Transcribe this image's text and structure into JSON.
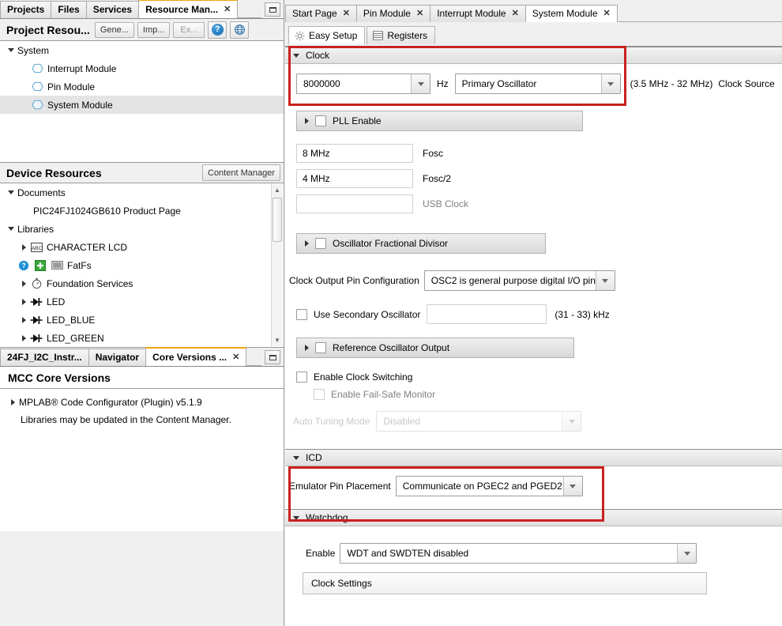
{
  "left_panel": {
    "tabs": [
      {
        "label": "Projects",
        "closable": false,
        "active": false
      },
      {
        "label": "Files",
        "closable": false,
        "active": false
      },
      {
        "label": "Services",
        "closable": false,
        "active": false
      },
      {
        "label": "Resource Man...",
        "closable": true,
        "active": true
      }
    ],
    "minimize_icon": "minimize-icon",
    "project_resources": {
      "title": "Project Resou...",
      "buttons": [
        {
          "label": "Gene...",
          "disabled": false
        },
        {
          "label": "Imp...",
          "disabled": false
        },
        {
          "label": "Ex...",
          "disabled": true
        }
      ],
      "help_label": "?",
      "globe_icon": "globe-icon",
      "tree": [
        {
          "label": "System",
          "level": 0,
          "expander": "down",
          "icon": null,
          "selected": false
        },
        {
          "label": "Interrupt Module",
          "level": 1,
          "expander": null,
          "icon": "hexagon-icon",
          "selected": false
        },
        {
          "label": "Pin Module",
          "level": 1,
          "expander": null,
          "icon": "hexagon-icon",
          "selected": false
        },
        {
          "label": "System Module",
          "level": 1,
          "expander": null,
          "icon": "hexagon-icon",
          "selected": true
        }
      ]
    },
    "device_resources": {
      "title": "Device Resources",
      "content_manager_label": "Content Manager",
      "tree": [
        {
          "label": "Documents",
          "level": 0,
          "expander": "down",
          "icon": null
        },
        {
          "label": "PIC24FJ1024GB610 Product Page",
          "level": 2,
          "expander": null,
          "icon": null
        },
        {
          "label": "Libraries",
          "level": 0,
          "expander": "down",
          "icon": null
        },
        {
          "label": "CHARACTER LCD",
          "level": 1,
          "expander": "right",
          "icon": "abc-icon"
        },
        {
          "label": "FatFs",
          "level": 1,
          "expander": null,
          "icon": "fatfs-icons"
        },
        {
          "label": "Foundation Services",
          "level": 1,
          "expander": "right",
          "icon": "stopwatch-icon"
        },
        {
          "label": "LED",
          "level": 1,
          "expander": "right",
          "icon": "diode-icon"
        },
        {
          "label": "LED_BLUE",
          "level": 1,
          "expander": "right",
          "icon": "diode-icon"
        },
        {
          "label": "LED_GREEN",
          "level": 1,
          "expander": "right",
          "icon": "diode-icon"
        }
      ]
    },
    "bottom_tabs": [
      {
        "label": "24FJ_I2C_Instr...",
        "closable": false,
        "active": false
      },
      {
        "label": "Navigator",
        "closable": false,
        "active": false
      },
      {
        "label": "Core Versions ...",
        "closable": true,
        "active": true
      }
    ],
    "core_versions": {
      "title": "MCC Core Versions",
      "plugin_row": "MPLAB® Code Configurator (Plugin) v5.1.9",
      "note": "Libraries may be updated in the Content Manager."
    }
  },
  "main_panel": {
    "tabs": [
      {
        "label": "Start Page",
        "closable": true,
        "active": false
      },
      {
        "label": "Pin Module",
        "closable": true,
        "active": false
      },
      {
        "label": "Interrupt Module",
        "closable": true,
        "active": false
      },
      {
        "label": "System Module",
        "closable": true,
        "active": true
      }
    ],
    "subtabs": [
      {
        "label": "Easy Setup",
        "icon": "gear-icon",
        "active": true
      },
      {
        "label": "Registers",
        "icon": "registers-icon",
        "active": false
      }
    ],
    "sections": {
      "clock": {
        "title": "Clock",
        "frequency_value": "8000000",
        "unit_label": "Hz",
        "source_value": "Primary Oscillator",
        "source_range_label": "(3.5 MHz - 32 MHz)",
        "source_label": "Clock Source",
        "pll_enable_label": "PLL Enable",
        "pll_checked": false,
        "fosc_value": "8 MHz",
        "fosc_label": "Fosc",
        "fosc2_value": "4 MHz",
        "fosc2_label": "Fosc/2",
        "usb_clock_value": "",
        "usb_clock_label": "USB Clock",
        "oscillator_fractional_divisor_label": "Oscillator Fractional Divisor",
        "ofd_checked": false,
        "clock_output_pin_label": "Clock Output Pin Configuration",
        "clock_output_pin_value": "OSC2 is general purpose digital I/O pin",
        "use_secondary_osc_label": "Use Secondary Oscillator",
        "use_secondary_osc_checked": false,
        "secondary_osc_value": "",
        "secondary_osc_range": "(31 - 33) kHz",
        "reference_osc_output_label": "Reference Oscillator Output",
        "reference_osc_checked": false,
        "enable_clock_switching_label": "Enable Clock Switching",
        "enable_clock_switching_checked": false,
        "enable_failsafe_label": "Enable Fail-Safe Monitor",
        "enable_failsafe_checked": false,
        "auto_tuning_label": "Auto Tuning Mode",
        "auto_tuning_value": "Disabled"
      },
      "icd": {
        "title": "ICD",
        "emulator_pin_label": "Emulator Pin Placement",
        "emulator_pin_value": "Communicate on PGEC2 and PGED2"
      },
      "watchdog": {
        "title": "Watchdog",
        "enable_label": "Enable",
        "enable_value": "WDT and SWDTEN disabled",
        "clock_settings_label": "Clock Settings"
      }
    }
  },
  "highlight_color": "#c9211e"
}
